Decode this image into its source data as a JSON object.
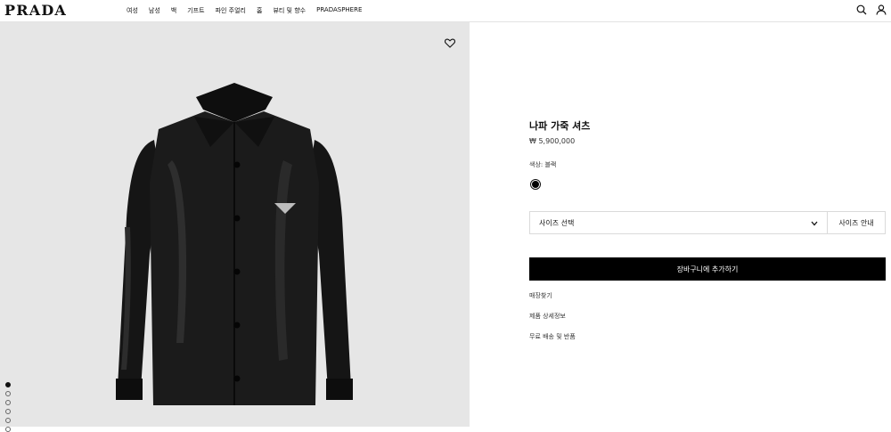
{
  "brand": "PRADA",
  "nav": [
    "여성",
    "남성",
    "백",
    "기프트",
    "파인 주얼리",
    "홈",
    "뷰티 및 향수",
    "PRADASPHERE"
  ],
  "header_icons": [
    "search-icon",
    "user-icon"
  ],
  "gallery": {
    "wishlist_icon": "heart-icon",
    "image": "black leather shirt jacket",
    "dot_count": 6,
    "active_index": 0
  },
  "product": {
    "name": "나파 가죽 셔츠",
    "price": "₩ 5,900,000",
    "color_label": "색상: 블랙",
    "color_swatch": "#000000",
    "size_select": "사이즈 선택",
    "size_guide": "사이즈 안내",
    "add_to_bag": "장바구니에 추가하기",
    "links": [
      "매장찾기",
      "제품 상세정보",
      "무료 배송 및 반품"
    ]
  },
  "colors": {
    "accent": "#000000",
    "image_bg": "#e6e6e6",
    "border": "#dadada"
  }
}
